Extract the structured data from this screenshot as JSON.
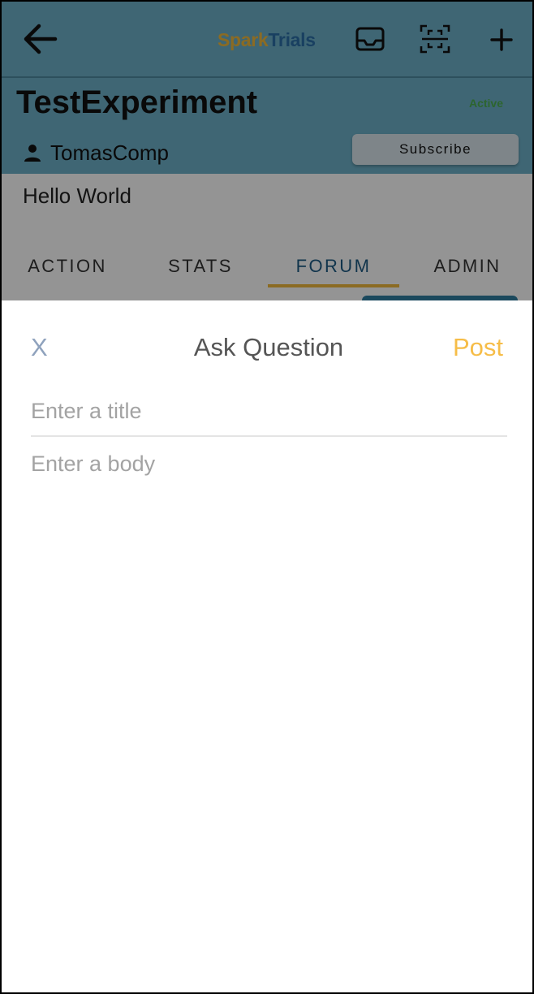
{
  "app": {
    "brand_part1": "Spark",
    "brand_part2": "Trials",
    "accent_yellow": "#f0b93d",
    "accent_blue": "#2c6fa8",
    "header_bg": "#6db0c8"
  },
  "topbar": {
    "back_icon": "arrow-left-icon",
    "icons": [
      "inbox-icon",
      "qr-scan-icon",
      "plus-icon"
    ]
  },
  "experiment": {
    "title": "TestExperiment",
    "status": "Active",
    "owner_icon": "person-icon",
    "owner": "TomasComp",
    "subscribe_label": "Subscribe",
    "description": "Hello World"
  },
  "tabs": [
    {
      "label": "ACTION",
      "active": false
    },
    {
      "label": "STATS",
      "active": false
    },
    {
      "label": "FORUM",
      "active": true
    },
    {
      "label": "ADMIN",
      "active": false
    }
  ],
  "sheet": {
    "close_label": "X",
    "title": "Ask Question",
    "post_label": "Post",
    "title_placeholder": "Enter a title",
    "body_placeholder": "Enter a body"
  }
}
